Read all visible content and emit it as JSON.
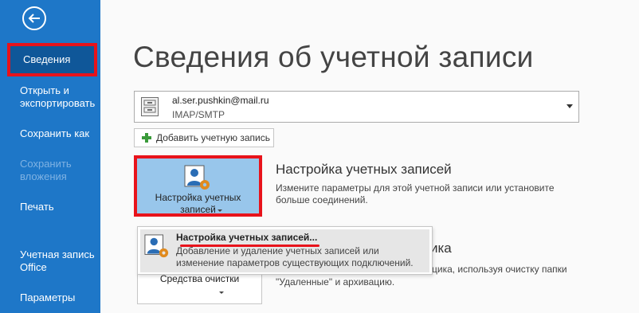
{
  "sidebar": {
    "items": [
      {
        "label": "Сведения"
      },
      {
        "label": "Открыть и экспортировать"
      },
      {
        "label": "Сохранить как"
      },
      {
        "label": "Сохранить вложения"
      },
      {
        "label": "Печать"
      },
      {
        "label": "Учетная запись Office"
      },
      {
        "label": "Параметры"
      }
    ]
  },
  "main": {
    "title": "Сведения об учетной записи",
    "account": {
      "email": "al.ser.pushkin@mail.ru",
      "type": "IMAP/SMTP"
    },
    "add_account_label": "Добавить учетную запись",
    "account_settings": {
      "tile_label": "Настройка учетных записей",
      "heading": "Настройка учетных записей",
      "description": "Измените параметры для этой учетной записи или установите больше соединений."
    },
    "cleanup": {
      "tile_label": "Средства очистки",
      "heading_tail": "ика",
      "desc_line1": "цика, используя очистку папки",
      "desc_line2": "\"Удаленные\" и архивацию."
    },
    "popup": {
      "title": "Настройка учетных записей...",
      "description": "Добавление и удаление учетных записей или изменение параметров существующих подключений."
    }
  },
  "colors": {
    "sidebar": "#1e77c8",
    "active_item": "#0f5799",
    "highlight_red": "#e8131b",
    "tile_selected": "#98c6eb"
  }
}
